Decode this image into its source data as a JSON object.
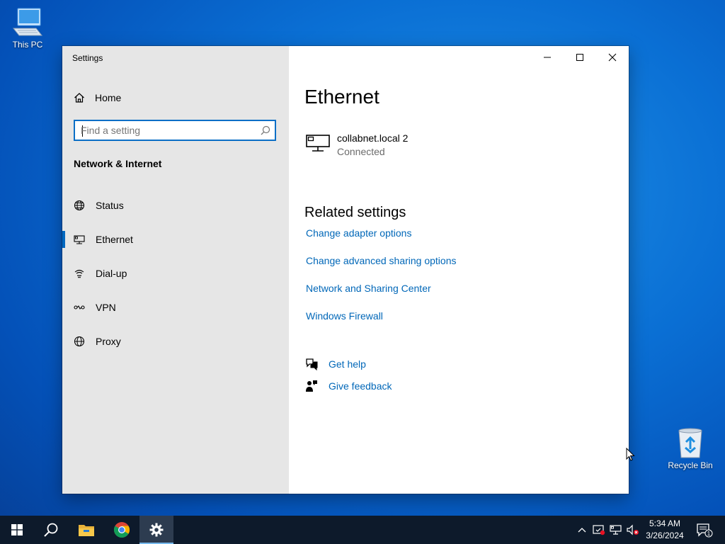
{
  "desktop": {
    "this_pc_label": "This PC",
    "recycle_bin_label": "Recycle Bin"
  },
  "window": {
    "title": "Settings",
    "controls": [
      "minimize",
      "maximize",
      "close"
    ]
  },
  "sidebar": {
    "home_label": "Home",
    "search_placeholder": "Find a setting",
    "section_title": "Network & Internet",
    "items": [
      {
        "label": "Status",
        "icon": "globe-status-icon",
        "active": false
      },
      {
        "label": "Ethernet",
        "icon": "ethernet-icon",
        "active": true
      },
      {
        "label": "Dial-up",
        "icon": "dialup-icon",
        "active": false
      },
      {
        "label": "VPN",
        "icon": "vpn-icon",
        "active": false
      },
      {
        "label": "Proxy",
        "icon": "globe-icon",
        "active": false
      }
    ]
  },
  "main": {
    "title": "Ethernet",
    "connection": {
      "name": "collabnet.local 2",
      "status": "Connected"
    },
    "related_title": "Related settings",
    "related_links": [
      "Change adapter options",
      "Change advanced sharing options",
      "Network and Sharing Center",
      "Windows Firewall"
    ],
    "help": {
      "get_help": "Get help",
      "give_feedback": "Give feedback"
    }
  },
  "taskbar": {
    "time": "5:34 AM",
    "date": "3/26/2024",
    "notification_count": "1"
  },
  "colors": {
    "accent": "#0067c0",
    "link": "#0067b8",
    "sidebar_bg": "#e6e6e6",
    "taskbar_bg": "#0d1a2b"
  }
}
